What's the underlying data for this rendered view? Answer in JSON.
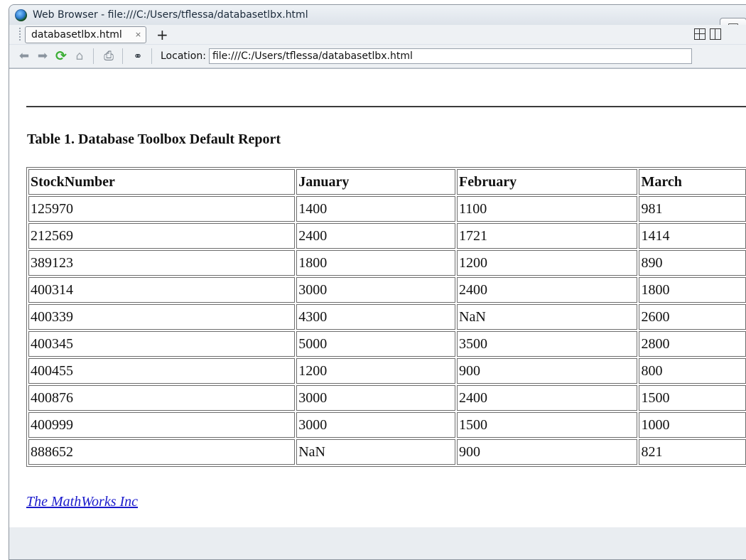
{
  "window": {
    "title": "Web Browser - file:///C:/Users/tflessa/databasetlbx.html"
  },
  "tabs": [
    {
      "label": "databasetlbx.html",
      "close": "×"
    }
  ],
  "new_tab": "+",
  "toolbar": {
    "location_label": "Location:",
    "location_value": "file:///C:/Users/tflessa/databasetlbx.html",
    "icons": [
      "back-arrow-icon",
      "forward-arrow-icon",
      "refresh-icon",
      "home-icon",
      "print-icon",
      "find-binoculars-icon"
    ]
  },
  "page": {
    "caption": "Table 1. Database Toolbox Default Report",
    "columns": [
      "StockNumber",
      "January",
      "February",
      "March"
    ],
    "rows": [
      [
        "125970",
        "1400",
        "1100",
        "981"
      ],
      [
        "212569",
        "2400",
        "1721",
        "1414"
      ],
      [
        "389123",
        "1800",
        "1200",
        "890"
      ],
      [
        "400314",
        "3000",
        "2400",
        "1800"
      ],
      [
        "400339",
        "4300",
        "NaN",
        "2600"
      ],
      [
        "400345",
        "5000",
        "3500",
        "2800"
      ],
      [
        "400455",
        "1200",
        "900",
        "800"
      ],
      [
        "400876",
        "3000",
        "2400",
        "1500"
      ],
      [
        "400999",
        "3000",
        "1500",
        "1000"
      ],
      [
        "888652",
        "NaN",
        "900",
        "821"
      ]
    ],
    "footer_link": "The MathWorks Inc"
  }
}
